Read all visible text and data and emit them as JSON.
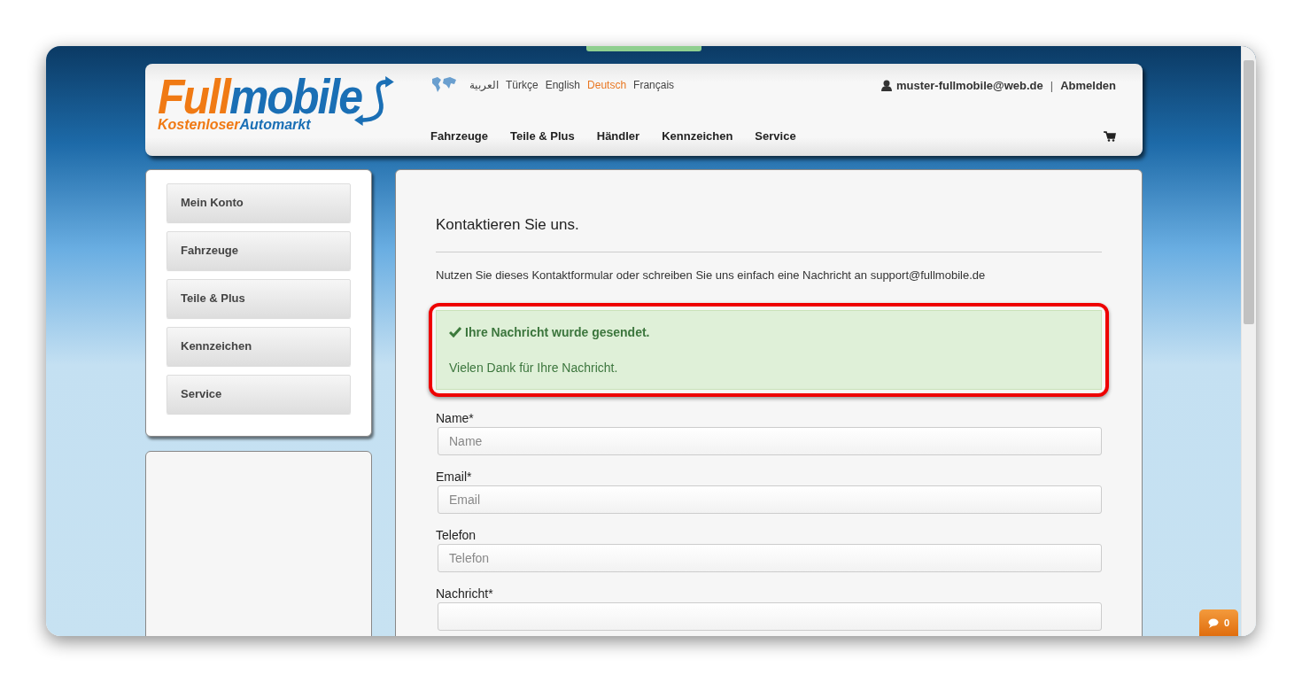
{
  "logo": {
    "word_1": "Full",
    "word_2": "mobile",
    "tagline_1": "Kostenloser",
    "tagline_2": "Automarkt"
  },
  "languages": [
    {
      "label": "العربية",
      "selected": false
    },
    {
      "label": "Türkçe",
      "selected": false
    },
    {
      "label": "English",
      "selected": false
    },
    {
      "label": "Deutsch",
      "selected": true
    },
    {
      "label": "Français",
      "selected": false
    }
  ],
  "user": {
    "email": "muster-fullmobile@web.de",
    "separator": "|",
    "logout": "Abmelden"
  },
  "nav": [
    "Fahrzeuge",
    "Teile & Plus",
    "Händler",
    "Kennzeichen",
    "Service"
  ],
  "sidebar": {
    "items": [
      "Mein Konto",
      "Fahrzeuge",
      "Teile & Plus",
      "Kennzeichen",
      "Service"
    ]
  },
  "main": {
    "title": "Kontaktieren Sie uns.",
    "intro": "Nutzen Sie dieses Kontaktformular oder schreiben Sie uns einfach eine Nachricht an support@fullmobile.de",
    "alert": {
      "heading": "Ihre Nachricht wurde gesendet.",
      "text": "Vielen Dank für Ihre Nachricht."
    },
    "fields": [
      {
        "label": "Name*",
        "placeholder": "Name"
      },
      {
        "label": "Email*",
        "placeholder": "Email"
      },
      {
        "label": "Telefon",
        "placeholder": "Telefon"
      },
      {
        "label": "Nachricht*"
      }
    ]
  },
  "chat": {
    "count": "0"
  }
}
